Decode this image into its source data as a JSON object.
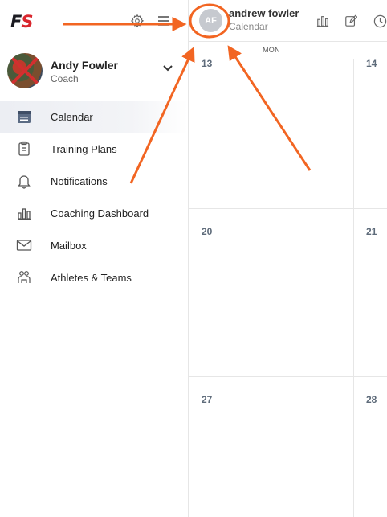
{
  "logo": {
    "part1": "F",
    "part2": "S"
  },
  "sidebar": {
    "top_icons": [
      "gear-icon",
      "hamburger-menu-icon"
    ],
    "profile": {
      "name": "Andy Fowler",
      "role": "Coach"
    },
    "nav_items": [
      {
        "label": "Calendar",
        "icon": "calendar-icon",
        "active": true
      },
      {
        "label": "Training Plans",
        "icon": "clipboard-icon",
        "active": false
      },
      {
        "label": "Notifications",
        "icon": "bell-icon",
        "active": false
      },
      {
        "label": "Coaching Dashboard",
        "icon": "bar-chart-icon",
        "active": false
      },
      {
        "label": "Mailbox",
        "icon": "envelope-icon",
        "active": false
      },
      {
        "label": "Athletes & Teams",
        "icon": "people-icon",
        "active": false
      }
    ]
  },
  "header": {
    "avatar_initials": "AF",
    "name": "andrew fowler",
    "subtitle": "Calendar",
    "icons": [
      "bar-chart-icon",
      "edit-icon",
      "clock-icon"
    ]
  },
  "calendar": {
    "day_name": "MON",
    "weeks": [
      {
        "left": "13",
        "right": "14"
      },
      {
        "left": "20",
        "right": "21"
      },
      {
        "left": "27",
        "right": "28"
      }
    ]
  },
  "colors": {
    "annotation": "#f26522",
    "logo_red": "#d9262d",
    "active_bg": "#eceef3"
  }
}
